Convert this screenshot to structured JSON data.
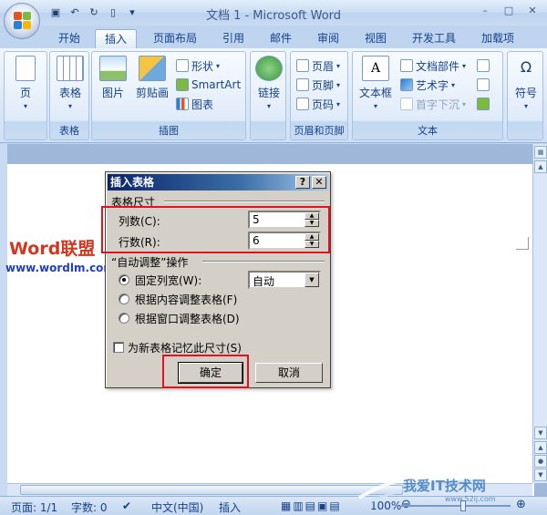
{
  "window": {
    "title": "文档 1 - Microsoft Word",
    "controls": [
      "–",
      "□",
      "✕"
    ]
  },
  "qat": [
    "save-icon",
    "undo-icon",
    "redo-icon",
    "new-icon",
    "customize-icon"
  ],
  "tabs": [
    {
      "label": "开始",
      "active": false
    },
    {
      "label": "插入",
      "active": true
    },
    {
      "label": "页面布局",
      "active": false
    },
    {
      "label": "引用",
      "active": false
    },
    {
      "label": "邮件",
      "active": false
    },
    {
      "label": "审阅",
      "active": false
    },
    {
      "label": "视图",
      "active": false
    },
    {
      "label": "开发工具",
      "active": false
    },
    {
      "label": "加载项",
      "active": false
    }
  ],
  "ribbon": {
    "pages": {
      "btn": "页",
      "arrow": "▾"
    },
    "tables": {
      "btn": "表格",
      "group": "表格"
    },
    "illustrations": {
      "picture": "图片",
      "clipart": "剪贴画",
      "shapes": "形状",
      "smartart": "SmartArt",
      "chart": "图表",
      "group": "插图"
    },
    "links": {
      "btn": "链接"
    },
    "header_footer": {
      "header": "页眉",
      "footer": "页脚",
      "page_number": "页码",
      "group": "页眉和页脚"
    },
    "text": {
      "textbox": "文本框",
      "quickparts": "文档部件",
      "wordart": "艺术字",
      "dropcap": "首字下沉",
      "group": "文本"
    },
    "symbols": {
      "btn": "符号",
      "glyph": "Ω"
    }
  },
  "document": {
    "logo_word": "Word",
    "logo_cn": "联盟",
    "url": "www.wordlm.com"
  },
  "dialog": {
    "title": "插入表格",
    "help": "?",
    "close": "✕",
    "section_size": "表格尺寸",
    "columns_label": "列数(C):",
    "columns_value": "5",
    "rows_label": "行数(R):",
    "rows_value": "6",
    "section_autofit": "“自动调整”操作",
    "fixed_width_label": "固定列宽(W):",
    "fixed_width_value": "自动",
    "autofit_contents": "根据内容调整表格(F)",
    "autofit_window": "根据窗口调整表格(D)",
    "remember": "为新表格记忆此尺寸(S)",
    "ok": "确定",
    "cancel": "取消"
  },
  "statusbar": {
    "page": "页面: 1/1",
    "words": "字数: 0",
    "language": "中文(中国)",
    "mode": "插入",
    "zoom": "100%"
  },
  "watermark": {
    "text": "我爱IT技术网",
    "sub": "www.52ij.com"
  }
}
